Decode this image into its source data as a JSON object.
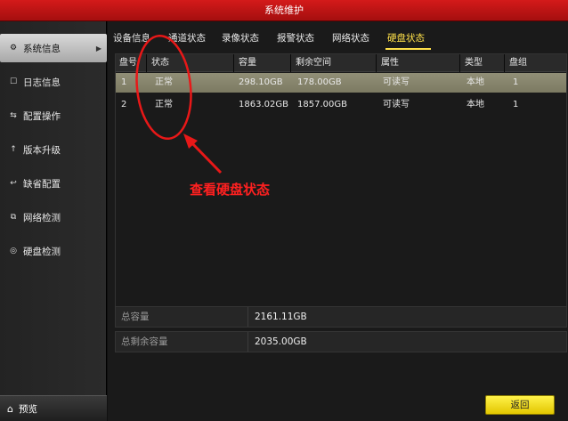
{
  "window": {
    "title": "系统维护"
  },
  "sidebar": {
    "items": [
      {
        "label": "系统信息",
        "icon": "gear-icon",
        "glyph": "⚙"
      },
      {
        "label": "日志信息",
        "icon": "log-icon",
        "glyph": "☐"
      },
      {
        "label": "配置操作",
        "icon": "config-icon",
        "glyph": "⇆"
      },
      {
        "label": "版本升级",
        "icon": "upgrade-icon",
        "glyph": "↑"
      },
      {
        "label": "缺省配置",
        "icon": "default-config-icon",
        "glyph": "↩"
      },
      {
        "label": "网络检测",
        "icon": "network-icon",
        "glyph": "⧉"
      },
      {
        "label": "硬盘检测",
        "icon": "disk-icon",
        "glyph": "◎"
      }
    ],
    "preview": {
      "label": "预览",
      "glyph": "⌂"
    }
  },
  "tabs": [
    "设备信息",
    "通道状态",
    "录像状态",
    "报警状态",
    "网络状态",
    "硬盘状态"
  ],
  "table": {
    "headers": [
      "盘号",
      "状态",
      "容量",
      "剩余空间",
      "属性",
      "类型",
      "盘组"
    ],
    "rows": [
      [
        "1",
        "正常",
        "298.10GB",
        "178.00GB",
        "可读写",
        "本地",
        "1"
      ],
      [
        "2",
        "正常",
        "1863.02GB",
        "1857.00GB",
        "可读写",
        "本地",
        "1"
      ]
    ]
  },
  "summary": {
    "total_label": "总容量",
    "total_value": "2161.11GB",
    "free_label": "总剩余容量",
    "free_value": "2035.00GB"
  },
  "buttons": {
    "back": "返回"
  },
  "annotation": {
    "text": "查看硬盘状态",
    "color": "#ff2020"
  },
  "colors": {
    "title_bar": "#c41414",
    "tab_active": "#ffe14a",
    "button": "#f0d800"
  }
}
